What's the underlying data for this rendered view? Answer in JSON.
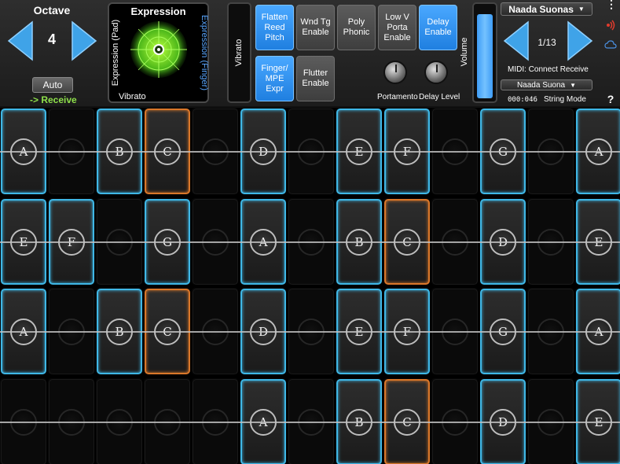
{
  "octave": {
    "title": "Octave",
    "value": "4",
    "auto_label": "Auto",
    "receive_label": "-> Receive"
  },
  "expression": {
    "title": "Expression",
    "left_label": "Expression (Pad)",
    "right_label": "Expression (Finger)",
    "bottom_label": "Vibrato"
  },
  "vibrato": {
    "label": "Vibrato"
  },
  "toggles": [
    {
      "label": "Flatten\nReed\nPitch",
      "state": "on"
    },
    {
      "label": "Wnd Tg\nEnable",
      "state": "off"
    },
    {
      "label": "Poly\nPhonic",
      "state": "off"
    },
    {
      "label": "Low V\nPorta\nEnable",
      "state": "off"
    },
    {
      "label": "Delay\nEnable",
      "state": "on"
    },
    {
      "label": "Finger/\nMPE\nExpr",
      "state": "on"
    },
    {
      "label": "Flutter\nEnable",
      "state": "off"
    }
  ],
  "knobs": {
    "portamento": "Portamento",
    "delay_level": "Delay Level"
  },
  "volume": {
    "label": "Volume",
    "level": 0.92
  },
  "preset": {
    "instrument": "Naada Suonas",
    "page": "1/13",
    "midi": "MIDI: Connect Receive",
    "sub_preset": "Naada Suona",
    "time": "000:046",
    "mode": "String Mode"
  },
  "side": {
    "menu_icon": "vertical-dots-icon",
    "help": "?",
    "accent": "#3fb7e6",
    "active": "#d9772a"
  },
  "rows": [
    [
      "A",
      "",
      "B",
      "C",
      "",
      "D",
      "",
      "E",
      "F",
      "",
      "G",
      "",
      "A"
    ],
    [
      "E",
      "F",
      "",
      "G",
      "",
      "A",
      "",
      "B",
      "C",
      "",
      "D",
      "",
      "E"
    ],
    [
      "A",
      "",
      "B",
      "C",
      "",
      "D",
      "",
      "E",
      "F",
      "",
      "G",
      "",
      "A"
    ],
    [
      "",
      "",
      "",
      "",
      "",
      "A",
      "",
      "B",
      "C",
      "",
      "D",
      "",
      "E"
    ]
  ],
  "highlight": [
    [
      false,
      false,
      false,
      true,
      false,
      false,
      false,
      false,
      false,
      false,
      false,
      false,
      false
    ],
    [
      false,
      false,
      false,
      false,
      false,
      false,
      false,
      false,
      true,
      false,
      false,
      false,
      false
    ],
    [
      false,
      false,
      false,
      true,
      false,
      false,
      false,
      false,
      false,
      false,
      false,
      false,
      false
    ],
    [
      false,
      false,
      false,
      false,
      false,
      false,
      false,
      false,
      true,
      false,
      false,
      false,
      false
    ]
  ]
}
